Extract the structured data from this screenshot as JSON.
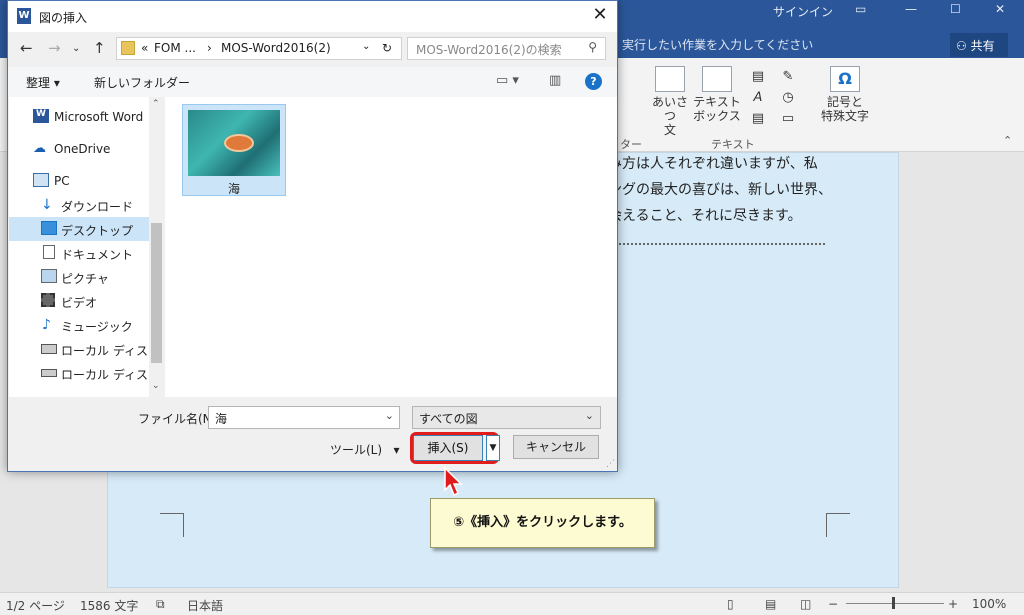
{
  "word": {
    "signin": "サインイン",
    "tell_me": "実行したい作業を入力してください",
    "share": "共有",
    "ribbon": {
      "aisatsu": "あいさつ文",
      "aisatsu_l1": "あいさつ",
      "aisatsu_l2": "文",
      "textbox_l1": "テキスト",
      "textbox_l2": "ボックス",
      "symbols_l1": "記号と",
      "symbols_l2": "特殊文字",
      "group_text": "テキスト",
      "group_cut": "ター"
    },
    "doc_lines": [
      "み方は人それぞれ違いますが、私",
      "ングの最大の喜びは、新しい世界、",
      "会えること、それに尽きます。"
    ],
    "status": {
      "pages": "1/2 ページ",
      "words": "1586 文字",
      "language": "日本語",
      "zoom": "100%"
    }
  },
  "dialog": {
    "title": "図の挿入",
    "close": "✕",
    "address": [
      "FOM ...",
      "MOS-Word2016(2)"
    ],
    "address_prefix": "«",
    "search_placeholder": "MOS-Word2016(2)の検索",
    "organize": "整理",
    "new_folder": "新しいフォルダー",
    "help": "?",
    "nav_items": [
      {
        "label": "Microsoft Word",
        "icon": "word-icon"
      },
      {
        "label": "OneDrive",
        "icon": "cloud-icon"
      },
      {
        "label": "PC",
        "icon": "pc-icon"
      },
      {
        "label": "ダウンロード",
        "icon": "download-icon"
      },
      {
        "label": "デスクトップ",
        "icon": "desktop-icon",
        "selected": true
      },
      {
        "label": "ドキュメント",
        "icon": "document-icon"
      },
      {
        "label": "ピクチャ",
        "icon": "picture-icon"
      },
      {
        "label": "ビデオ",
        "icon": "video-icon"
      },
      {
        "label": "ミュージック",
        "icon": "music-icon"
      },
      {
        "label": "ローカル ディスク (C",
        "icon": "drive-icon"
      },
      {
        "label": "ローカル ディスク (D",
        "icon": "drive-icon"
      }
    ],
    "file": {
      "name": "海"
    },
    "filename_label": "ファイル名(N):",
    "filename_value": "海",
    "filter_value": "すべての図",
    "tools_label": "ツール(L)",
    "insert_label": "挿入(S)",
    "cancel_label": "キャンセル"
  },
  "callout": "⑤《挿入》をクリックします。",
  "colors": {
    "accent": "#2b579a",
    "highlight": "#e21b1b",
    "selection": "#cce4f7",
    "callout": "#fdfbd1"
  }
}
